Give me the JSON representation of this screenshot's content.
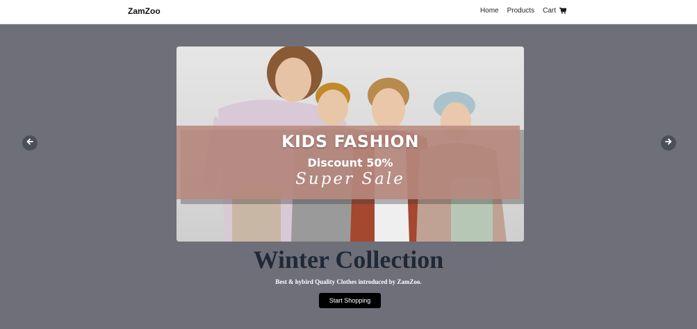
{
  "navbar": {
    "brand": "ZamZoo",
    "links": [
      {
        "label": "Home"
      },
      {
        "label": "Products"
      },
      {
        "label": "Cart",
        "icon": "cart-icon"
      }
    ]
  },
  "carousel": {
    "prev_icon": "arrow-left-icon",
    "next_icon": "arrow-right-icon",
    "slide": {
      "banner_title": "KIDS FASHION",
      "banner_discount": "Discount 50%",
      "banner_tagline": "Super Sale",
      "banner_color": "#b98a80"
    },
    "caption": {
      "title": "Winter Collection",
      "subtitle": "Best & hybird Quality Clothes introduced by ZamZoo.",
      "button_label": "Start Shopping"
    }
  },
  "colors": {
    "hero_background": "#6f6f79",
    "caption_title": "#1f2937",
    "button_background": "#000000"
  }
}
